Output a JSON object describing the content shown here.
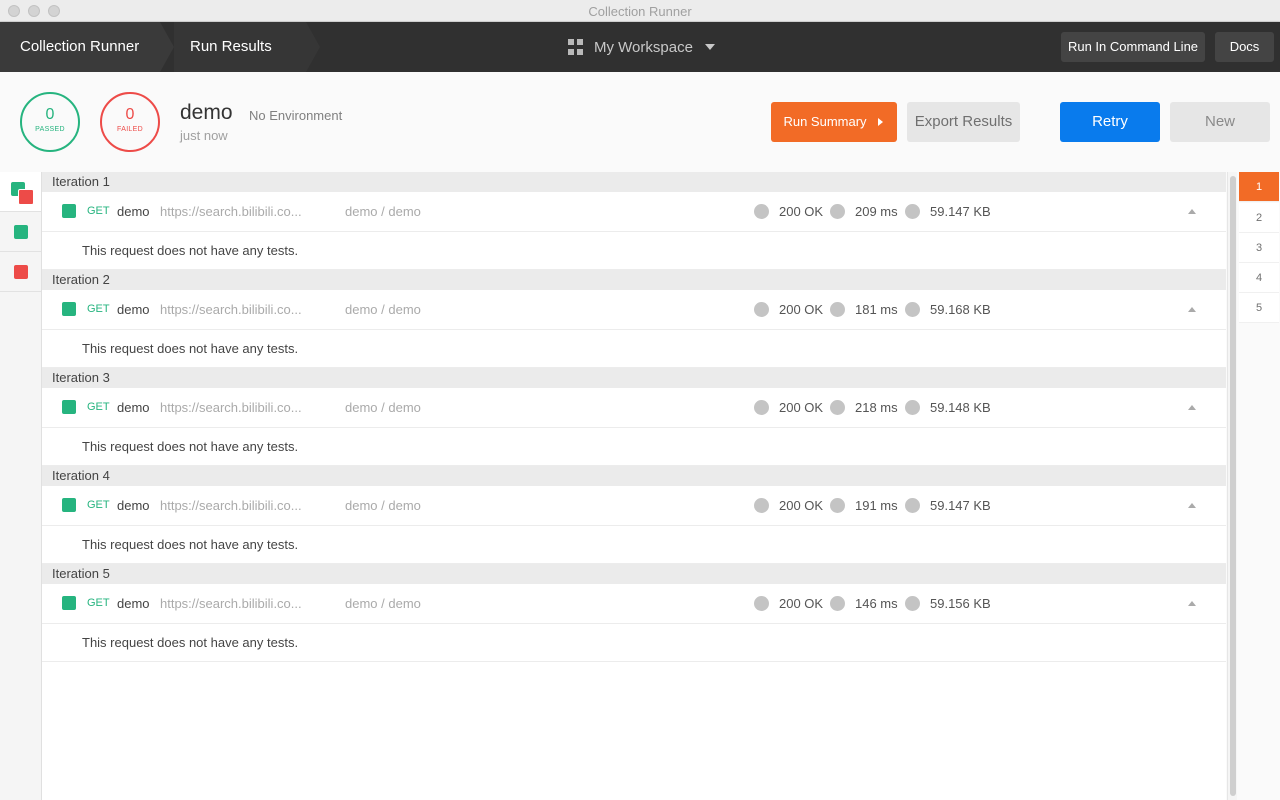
{
  "window": {
    "title": "Collection Runner"
  },
  "header": {
    "breadcrumbs": [
      "Collection Runner",
      "Run Results"
    ],
    "workspace": "My Workspace",
    "cli_button": "Run In Command Line",
    "docs_button": "Docs"
  },
  "summary": {
    "passed": {
      "count": "0",
      "label": "PASSED"
    },
    "failed": {
      "count": "0",
      "label": "FAILED"
    },
    "run_name": "demo",
    "environment": "No Environment",
    "time": "just now",
    "run_summary_button": "Run Summary",
    "export_button": "Export Results",
    "retry_button": "Retry",
    "new_button": "New"
  },
  "colors": {
    "pass": "#26b47f",
    "fail": "#ed4b48",
    "accent_orange": "#f26b26",
    "accent_blue": "#097bed"
  },
  "iterations": [
    {
      "label": "Iteration 1",
      "method": "GET",
      "name": "demo",
      "url": "https://search.bilibili.co...",
      "path": "demo / demo",
      "status": "200 OK",
      "time": "209 ms",
      "size": "59.147 KB",
      "message": "This request does not have any tests."
    },
    {
      "label": "Iteration 2",
      "method": "GET",
      "name": "demo",
      "url": "https://search.bilibili.co...",
      "path": "demo / demo",
      "status": "200 OK",
      "time": "181 ms",
      "size": "59.168 KB",
      "message": "This request does not have any tests."
    },
    {
      "label": "Iteration 3",
      "method": "GET",
      "name": "demo",
      "url": "https://search.bilibili.co...",
      "path": "demo / demo",
      "status": "200 OK",
      "time": "218 ms",
      "size": "59.148 KB",
      "message": "This request does not have any tests."
    },
    {
      "label": "Iteration 4",
      "method": "GET",
      "name": "demo",
      "url": "https://search.bilibili.co...",
      "path": "demo / demo",
      "status": "200 OK",
      "time": "191 ms",
      "size": "59.147 KB",
      "message": "This request does not have any tests."
    },
    {
      "label": "Iteration 5",
      "method": "GET",
      "name": "demo",
      "url": "https://search.bilibili.co...",
      "path": "demo / demo",
      "status": "200 OK",
      "time": "146 ms",
      "size": "59.156 KB",
      "message": "This request does not have any tests."
    }
  ],
  "pager": {
    "pages": [
      "1",
      "2",
      "3",
      "4",
      "5"
    ],
    "active": "1"
  }
}
